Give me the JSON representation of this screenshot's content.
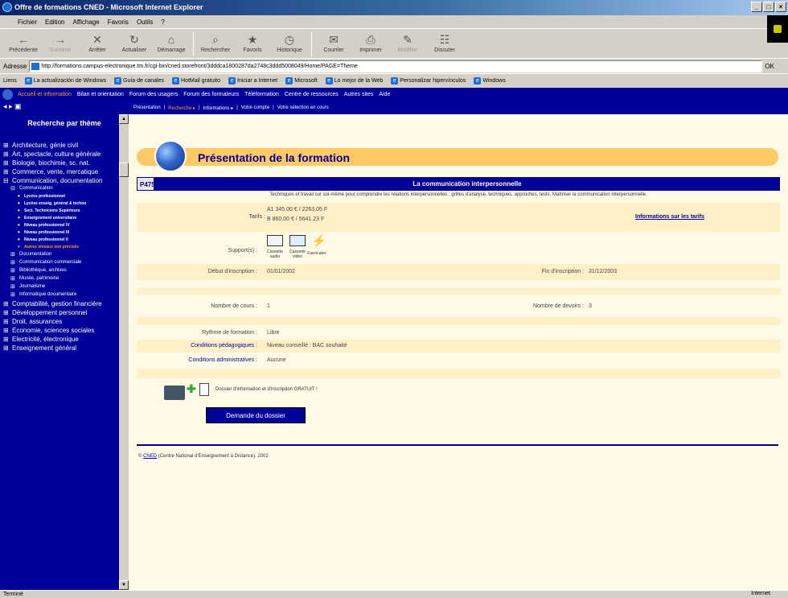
{
  "window": {
    "title": "Offre de formations CNED - Microsoft Internet Explorer",
    "controls": [
      "_",
      "□",
      "×"
    ]
  },
  "menu": [
    "Fichier",
    "Edition",
    "Affichage",
    "Favoris",
    "Outils",
    "?"
  ],
  "toolbar": [
    {
      "label": "Précédente",
      "icon": "back-icon",
      "glyph": "←"
    },
    {
      "label": "Suivante",
      "icon": "forward-icon",
      "glyph": "→"
    },
    {
      "label": "Arrêter",
      "icon": "stop-icon",
      "glyph": "✕"
    },
    {
      "label": "Actualiser",
      "icon": "refresh-icon",
      "glyph": "↻"
    },
    {
      "label": "Démarrage",
      "icon": "home-icon",
      "glyph": "⌂"
    },
    {
      "label": "Rechercher",
      "icon": "search-icon",
      "glyph": "⌕"
    },
    {
      "label": "Favoris",
      "icon": "favorites-icon",
      "glyph": "★"
    },
    {
      "label": "Historique",
      "icon": "history-icon",
      "glyph": "◷"
    },
    {
      "label": "Courrier",
      "icon": "mail-icon",
      "glyph": "✉"
    },
    {
      "label": "Imprimer",
      "icon": "print-icon",
      "glyph": "⎙"
    },
    {
      "label": "Modifier",
      "icon": "edit-icon",
      "glyph": "✎"
    },
    {
      "label": "Discuter",
      "icon": "discuss-icon",
      "glyph": "☷"
    }
  ],
  "address": {
    "label": "Adresse",
    "url": "http://formations.campus-electronique.tm.fr/cgi-bin/cned.storefront/3dddca1800287da2748c3ddd5008049/Home/PAGE=Theme",
    "go": "OK"
  },
  "links": {
    "label": "Liens",
    "items": [
      "La actualización de Windows",
      "Guía de canales",
      "HotMail gratuito",
      "Iniciar a Internet",
      "Microsoft",
      "Lo mejor de la Web",
      "Personalizar hipervínculos",
      "Windows"
    ]
  },
  "site": {
    "topnav": [
      "Accueil et information",
      "Bilan et orientation",
      "Forum des usagers",
      "Forum des formateurs",
      "Téléformation",
      "Centre de ressources",
      "Autres sites",
      "Aide"
    ],
    "subnav": [
      "Présentation",
      "Recherche ▸",
      "Informations ▸",
      "Votre compte",
      "Votre sélection en cours"
    ],
    "sidebar_title": "Recherche par thème",
    "sidebar_items": [
      {
        "label": "Architecture, génie civil",
        "kind": "top",
        "open": false
      },
      {
        "label": "Art, spectacle, culture générale",
        "kind": "top",
        "open": false
      },
      {
        "label": "Biologie, biochimie, sc. nat.",
        "kind": "top",
        "open": false
      },
      {
        "label": "Commerce, vente, mercatique",
        "kind": "top",
        "open": false
      },
      {
        "label": "Communication, documentation",
        "kind": "top",
        "open": true
      },
      {
        "label": "Communication",
        "kind": "sub",
        "open": true
      },
      {
        "label": "Lycées professionnel",
        "kind": "leaf",
        "active": false
      },
      {
        "label": "Lycées enseig. général & techno",
        "kind": "leaf",
        "active": false
      },
      {
        "label": "Sect. Techniciens Supérieurs",
        "kind": "leaf",
        "active": false
      },
      {
        "label": "Enseignement universitaire",
        "kind": "leaf",
        "active": false
      },
      {
        "label": "Niveau professionnel IV",
        "kind": "leaf",
        "active": false
      },
      {
        "label": "Niveau professionnel III",
        "kind": "leaf",
        "active": false
      },
      {
        "label": "Niveau professionnel II",
        "kind": "leaf",
        "active": false
      },
      {
        "label": "Autres niveaux non précisés",
        "kind": "leaf",
        "active": true
      },
      {
        "label": "Documentation",
        "kind": "sub",
        "open": false
      },
      {
        "label": "Communication commerciale",
        "kind": "sub",
        "open": false
      },
      {
        "label": "Bibliothèque, archives",
        "kind": "sub",
        "open": false
      },
      {
        "label": "Musée, patrimoine",
        "kind": "sub",
        "open": false
      },
      {
        "label": "Journalisme",
        "kind": "sub",
        "open": false
      },
      {
        "label": "Informatique documentaire",
        "kind": "sub",
        "open": false
      },
      {
        "label": "Comptabilité, gestion financière",
        "kind": "top",
        "open": false
      },
      {
        "label": "Développement personnel",
        "kind": "top",
        "open": false
      },
      {
        "label": "Droit, assurances",
        "kind": "top",
        "open": false
      },
      {
        "label": "Economie, sciences sociales",
        "kind": "top",
        "open": false
      },
      {
        "label": "Electricité, électronique",
        "kind": "top",
        "open": false
      },
      {
        "label": "Enseignement général",
        "kind": "top",
        "open": false
      }
    ],
    "page_title": "Présentation de la formation",
    "course": {
      "code": "P4750",
      "title": "La communication interpersonnelle",
      "description": "Techniques et travail sur soi-même pour comprendre les relations interpersonnelles : grilles d'analyse, techniques, approches, tests. Maîtriser la communication interpersonnelle.",
      "tarifs_label": "Tarifs :",
      "tarif_a": "A1  345.00 € / 2263.05 F",
      "tarif_b": "B   860.00 € / 5641.23 F",
      "tarifs_link": "Informations sur les tarifs",
      "supports_label": "Support(s) :",
      "supports": [
        "Cassette audio",
        "Cassette vidéo",
        "Fascicules"
      ],
      "debut_label": "Début d'inscription :",
      "debut_value": "01/01/2002",
      "fin_label": "Fin d'inscription :",
      "fin_value": "31/12/2003",
      "cours_label": "Nombre de cours :",
      "cours_value": "1",
      "devoirs_label": "Nombre de devoirs :",
      "devoirs_value": "3",
      "rythme_label": "Rythme de formation :",
      "rythme_value": "Libre",
      "pedago_label": "Conditions pédagogiques :",
      "pedago_value": "Niveau conseillé : BAC souhaité",
      "admin_label": "Conditions administratives :",
      "admin_value": "Aucune",
      "dossier_text": "Dossier d'information et d'inscription GRATUIT !",
      "request_button": "Demande du dossier"
    },
    "footer_link": "CNED",
    "footer_text": "(Centre National d'Enseignement à Distance), 2002",
    "footer_prefix": "© "
  },
  "status": {
    "left": "Terminé",
    "zone": "Internet"
  },
  "colors": {
    "nav": "#000099",
    "accent": "#ff9933",
    "band": "#fff0c8",
    "banner": "#ffc966",
    "page": "#fffae6"
  }
}
